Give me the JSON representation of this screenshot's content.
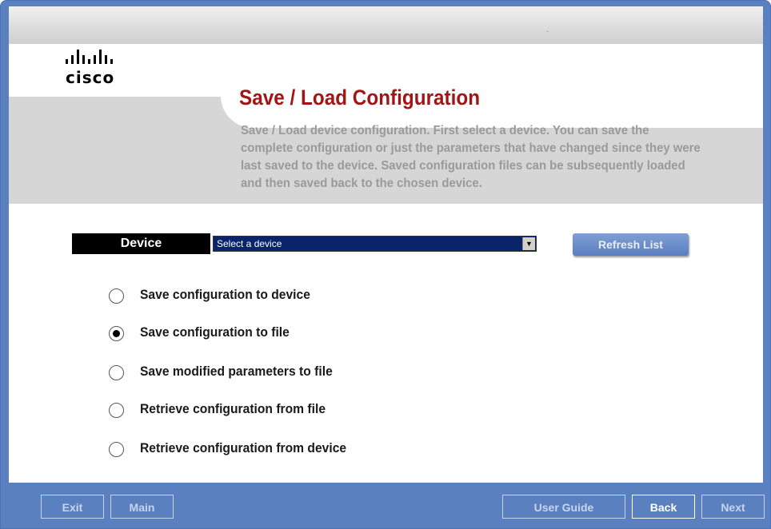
{
  "logo": {
    "text": "cisco"
  },
  "page": {
    "title": "Save / Load Configuration",
    "description": "Save / Load device configuration. First select a device. You can save the complete configuration or just the parameters that have changed since they were last saved to the device. Saved configuration files can be subsequently loaded and then saved back to the chosen device."
  },
  "device": {
    "label": "Device",
    "selected": "Select a device",
    "refresh_label": "Refresh List"
  },
  "options": [
    {
      "label": "Save configuration to device",
      "selected": false
    },
    {
      "label": "Save configuration to file",
      "selected": true
    },
    {
      "label": "Save modified parameters to file",
      "selected": false
    },
    {
      "label": "Retrieve configuration from file",
      "selected": false
    },
    {
      "label": "Retrieve configuration from device",
      "selected": false
    }
  ],
  "footer": {
    "exit": "Exit",
    "main": "Main",
    "user_guide": "User Guide",
    "back": "Back",
    "next": "Next"
  },
  "colors": {
    "title": "#a31515",
    "frame": "#5b80c0",
    "button": "#6a8dcb"
  }
}
